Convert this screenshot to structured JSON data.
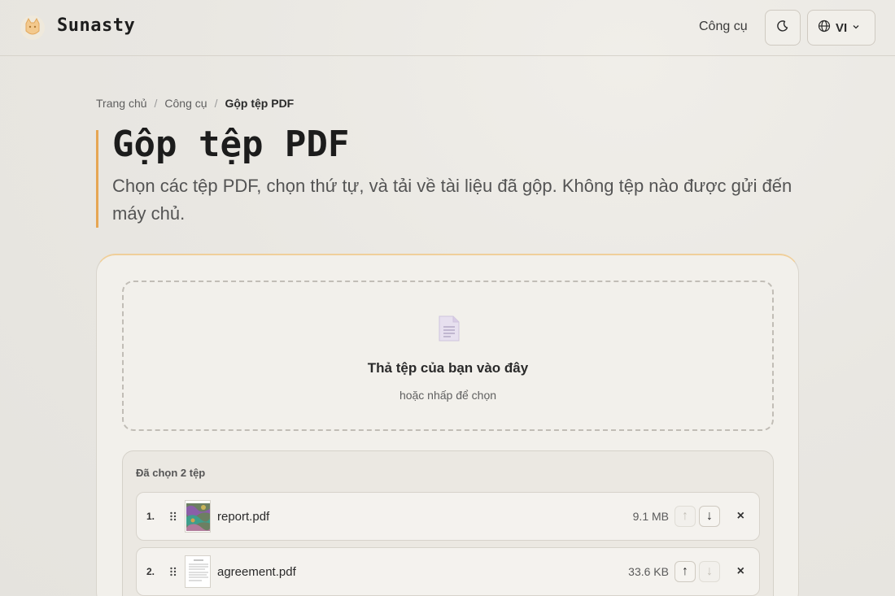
{
  "header": {
    "brand": "Sunasty",
    "nav_tools": "Công cụ",
    "lang_code": "VI",
    "logo_icon": "cat-logo-icon",
    "theme_icon": "moon-icon",
    "lang_icon": "globe-icon"
  },
  "breadcrumb": {
    "items": [
      "Trang chủ",
      "Công cụ"
    ],
    "separator": "/",
    "current": "Gộp tệp PDF"
  },
  "page": {
    "title": "Gộp tệp PDF",
    "description": "Chọn các tệp PDF, chọn thứ tự, và tải về tài liệu đã gộp. Không tệp nào được gửi đến máy chủ."
  },
  "dropzone": {
    "icon": "document-icon",
    "title": "Thả tệp của bạn vào đây",
    "subtitle": "hoặc nhấp để chọn"
  },
  "files": {
    "count_label": "Đã chọn 2 tệp",
    "items": [
      {
        "index": "1.",
        "name": "report.pdf",
        "size": "9.1 MB",
        "up_enabled": false,
        "down_enabled": true
      },
      {
        "index": "2.",
        "name": "agreement.pdf",
        "size": "33.6 KB",
        "up_enabled": true,
        "down_enabled": false
      }
    ],
    "up_symbol": "↑",
    "down_symbol": "↓",
    "remove_symbol": "×"
  },
  "colors": {
    "accent": "#e6a653",
    "background": "#e9e7e2"
  }
}
